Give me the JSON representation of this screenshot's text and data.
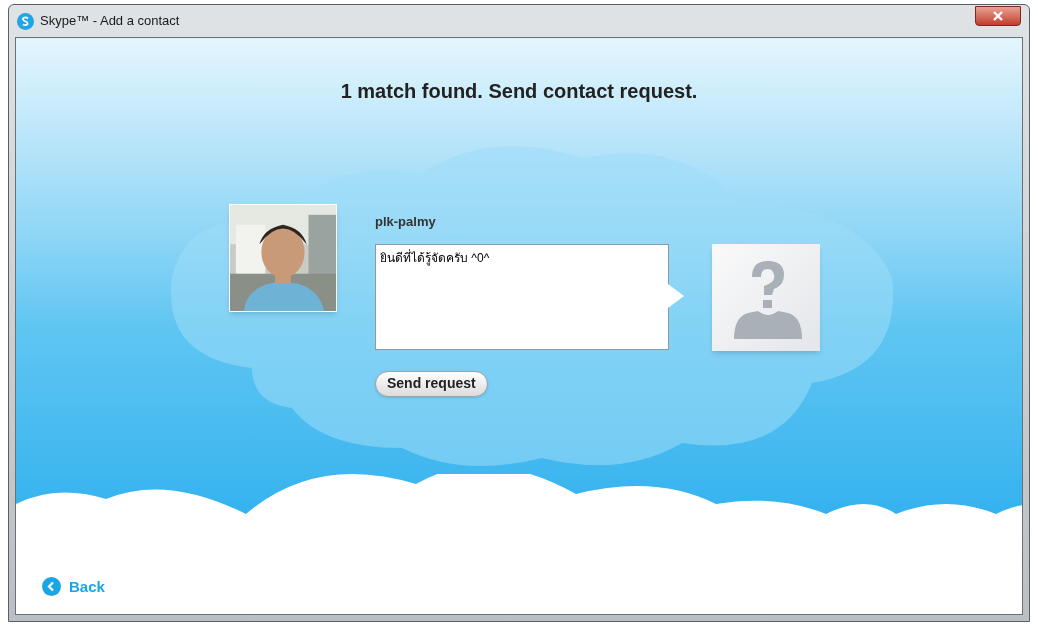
{
  "window": {
    "title": "Skype™ - Add a contact"
  },
  "heading": "1 match found. Send contact request.",
  "contact": {
    "name": "plk-palmy"
  },
  "message": {
    "value": "ยินดีที่ได้รู้จัดครับ ^0^"
  },
  "send_button": "Send request",
  "back_link": "Back"
}
